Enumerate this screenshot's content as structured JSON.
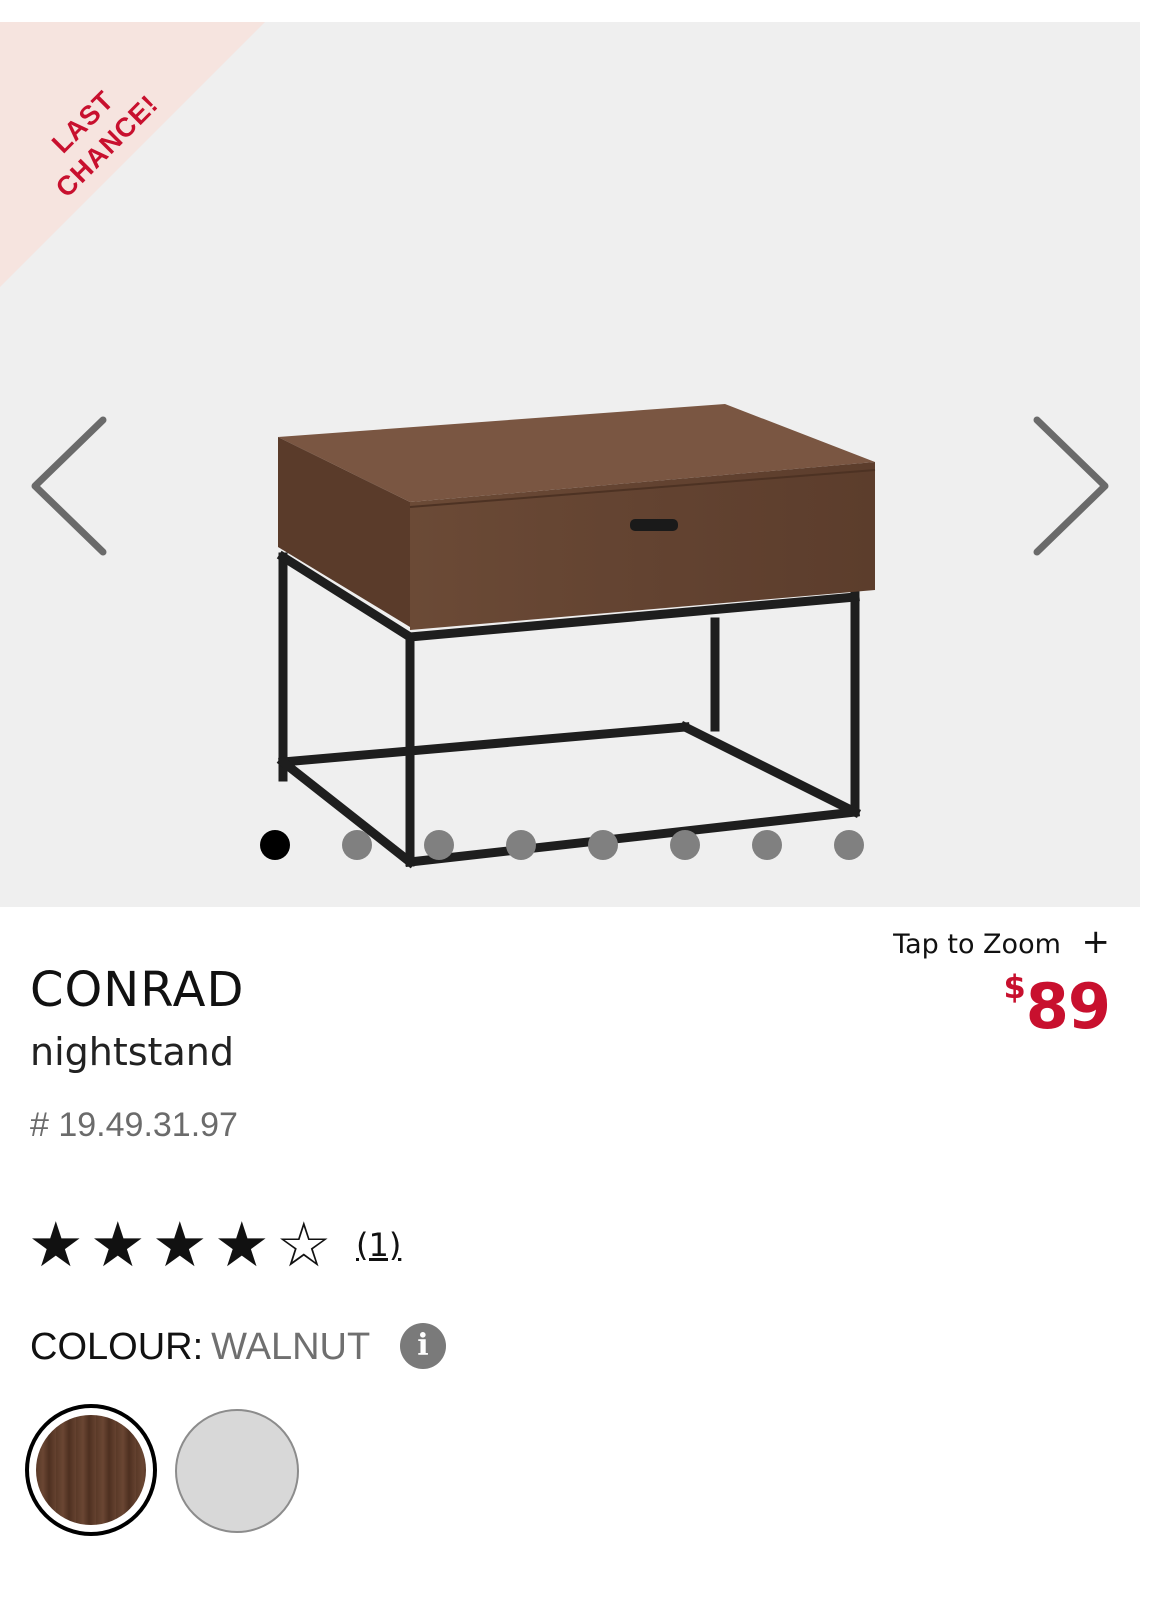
{
  "badge": {
    "text": "LAST CHANCE!"
  },
  "gallery": {
    "total_images": 8,
    "active_index": 0
  },
  "zoom": {
    "label": "Tap to Zoom",
    "icon": "plus-icon"
  },
  "product": {
    "name": "CONRAD",
    "type": "nightstand",
    "sku": "# 19.49.31.97",
    "price_currency": "$",
    "price_amount": "89"
  },
  "rating": {
    "value": 4,
    "max": 5,
    "review_count": "(1)"
  },
  "colour": {
    "label": "COLOUR:",
    "selected": "WALNUT",
    "info_icon": "info-icon"
  },
  "swatches": [
    {
      "name": "walnut",
      "color": "#5a3a28",
      "selected": true
    },
    {
      "name": "grey",
      "color": "#d8d8d8",
      "selected": false
    }
  ],
  "theme": {
    "accent": "#c8102e",
    "badge_bg": "#f6e4df",
    "gallery_bg": "#efefef"
  }
}
